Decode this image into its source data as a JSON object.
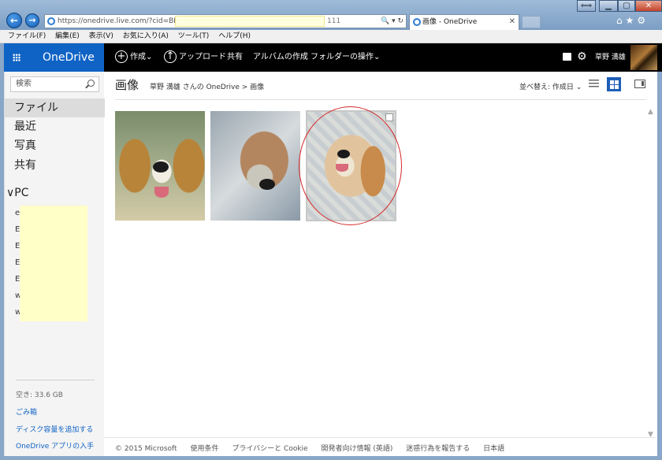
{
  "browser": {
    "url_visible": "https://onedrive.live.com/?cid=BE20",
    "url_tail": "111",
    "tab_title": "画像 - OneDrive",
    "tab_close": "✕",
    "back_glyph": "←",
    "forward_glyph": "→",
    "addr_icons": "🔍 ▾ ↻",
    "window_extra": "⟺",
    "window_min": "▁",
    "window_max": "▢",
    "window_close": "✕",
    "toolbar_icons": "⌂★⚙",
    "menu": [
      "ファイル(F)",
      "編集(E)",
      "表示(V)",
      "お気に入り(A)",
      "ツール(T)",
      "ヘルプ(H)"
    ]
  },
  "header": {
    "brand": "OneDrive",
    "commands": {
      "new": "作成",
      "upload": "アップロード",
      "share": "共有",
      "album": "アルバムの作成",
      "folder": "フォルダーの操作"
    },
    "plus_glyph": "+",
    "upload_glyph": "↑",
    "chevron": "⌄",
    "gear_glyph": "⚙",
    "user_name": "草野 満雄"
  },
  "leftnav": {
    "search_placeholder": "検索",
    "items": [
      "ファイル",
      "最近",
      "写真",
      "共有"
    ],
    "pc_label": "PC",
    "pc_chevron": "∨",
    "pc_items": [
      "e",
      "E",
      "E",
      "E",
      "E",
      "w",
      "w"
    ],
    "storage": "空き: 33.6 GB",
    "links": [
      "ごみ箱",
      "ディスク容量を追加する",
      "OneDrive アプリの入手"
    ]
  },
  "main": {
    "title": "画像",
    "breadcrumb": "草野 満雄 さんの OneDrive > 画像",
    "sort_label": "並べ替え: 作成日 ⌄",
    "scroll_up": "▲",
    "scroll_down": "▼"
  },
  "footer": [
    "© 2015 Microsoft",
    "使用条件",
    "プライバシーと Cookie",
    "開発者向け情報 (英語)",
    "迷惑行為を報告する",
    "日本語"
  ],
  "colors": {
    "brand_blue": "#0f63c5",
    "header_bg": "#000000",
    "highlight_red": "#d62828"
  }
}
